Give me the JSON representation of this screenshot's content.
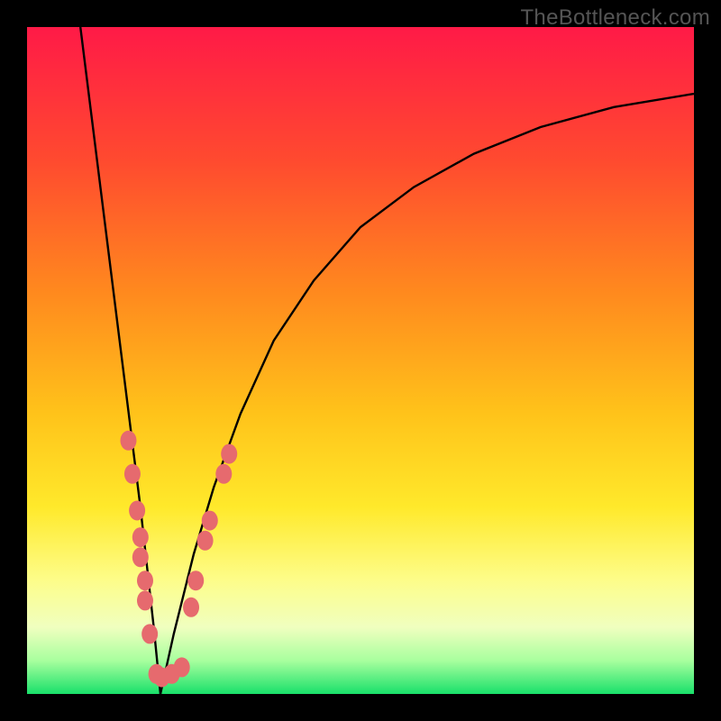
{
  "watermark": "TheBottleneck.com",
  "chart_data": {
    "type": "line",
    "title": "",
    "xlabel": "",
    "ylabel": "",
    "xlim": [
      0,
      100
    ],
    "ylim": [
      0,
      100
    ],
    "gradient_stops": [
      {
        "offset": 0.0,
        "color": "#ff1a47"
      },
      {
        "offset": 0.2,
        "color": "#ff4a2f"
      },
      {
        "offset": 0.4,
        "color": "#ff8a1e"
      },
      {
        "offset": 0.58,
        "color": "#ffc31a"
      },
      {
        "offset": 0.72,
        "color": "#ffe92b"
      },
      {
        "offset": 0.83,
        "color": "#fdfd8a"
      },
      {
        "offset": 0.9,
        "color": "#f0ffbf"
      },
      {
        "offset": 0.95,
        "color": "#a8ff9e"
      },
      {
        "offset": 1.0,
        "color": "#19e06a"
      }
    ],
    "curve": {
      "min_x": 20,
      "left_branch": [
        {
          "x": 8.0,
          "y": 100.0
        },
        {
          "x": 9.0,
          "y": 92.0
        },
        {
          "x": 10.0,
          "y": 84.0
        },
        {
          "x": 11.0,
          "y": 76.0
        },
        {
          "x": 12.0,
          "y": 68.0
        },
        {
          "x": 13.0,
          "y": 60.0
        },
        {
          "x": 14.0,
          "y": 52.0
        },
        {
          "x": 15.0,
          "y": 44.0
        },
        {
          "x": 16.0,
          "y": 36.0
        },
        {
          "x": 17.0,
          "y": 28.0
        },
        {
          "x": 18.0,
          "y": 19.0
        },
        {
          "x": 19.0,
          "y": 10.0
        },
        {
          "x": 20.0,
          "y": 0.0
        }
      ],
      "right_branch": [
        {
          "x": 20.0,
          "y": 0.0
        },
        {
          "x": 22.0,
          "y": 9.0
        },
        {
          "x": 25.0,
          "y": 21.0
        },
        {
          "x": 28.0,
          "y": 31.0
        },
        {
          "x": 32.0,
          "y": 42.0
        },
        {
          "x": 37.0,
          "y": 53.0
        },
        {
          "x": 43.0,
          "y": 62.0
        },
        {
          "x": 50.0,
          "y": 70.0
        },
        {
          "x": 58.0,
          "y": 76.0
        },
        {
          "x": 67.0,
          "y": 81.0
        },
        {
          "x": 77.0,
          "y": 85.0
        },
        {
          "x": 88.0,
          "y": 88.0
        },
        {
          "x": 100.0,
          "y": 90.0
        }
      ]
    },
    "markers": [
      {
        "x": 15.2,
        "y": 38.0
      },
      {
        "x": 15.8,
        "y": 33.0
      },
      {
        "x": 16.5,
        "y": 27.5
      },
      {
        "x": 17.0,
        "y": 23.5
      },
      {
        "x": 17.0,
        "y": 20.5
      },
      {
        "x": 17.7,
        "y": 17.0
      },
      {
        "x": 17.7,
        "y": 14.0
      },
      {
        "x": 18.4,
        "y": 9.0
      },
      {
        "x": 19.4,
        "y": 3.0
      },
      {
        "x": 20.2,
        "y": 2.5
      },
      {
        "x": 21.7,
        "y": 3.0
      },
      {
        "x": 23.2,
        "y": 4.0
      },
      {
        "x": 24.6,
        "y": 13.0
      },
      {
        "x": 25.3,
        "y": 17.0
      },
      {
        "x": 26.7,
        "y": 23.0
      },
      {
        "x": 27.4,
        "y": 26.0
      },
      {
        "x": 29.5,
        "y": 33.0
      },
      {
        "x": 30.3,
        "y": 36.0
      }
    ],
    "marker_color": "#e66a6e",
    "curve_color": "#000000"
  }
}
